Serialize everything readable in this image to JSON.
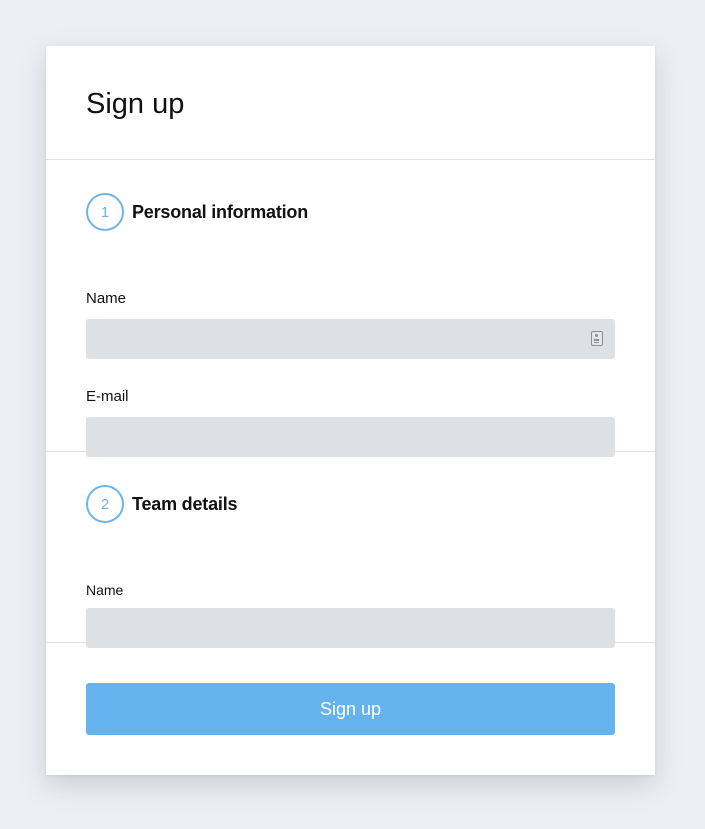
{
  "form": {
    "title": "Sign up",
    "sections": [
      {
        "step_number": "1",
        "heading": "Personal information",
        "fields": [
          {
            "label": "Name",
            "value": "",
            "placeholder": ""
          },
          {
            "label": "E-mail",
            "value": "",
            "placeholder": ""
          }
        ]
      },
      {
        "step_number": "2",
        "heading": "Team details",
        "fields": [
          {
            "label": "Name",
            "value": "",
            "placeholder": ""
          }
        ]
      }
    ],
    "submit_label": "Sign up"
  },
  "icons": {
    "name_field_autofill": "contact-card-icon"
  },
  "colors": {
    "page_background": "#ebf0f4",
    "card_background": "#ffffff",
    "input_background": "#dce1e5",
    "step_accent": "#6db5e4",
    "submit_button": "#64b3ec",
    "divider": "#dde2e6"
  }
}
